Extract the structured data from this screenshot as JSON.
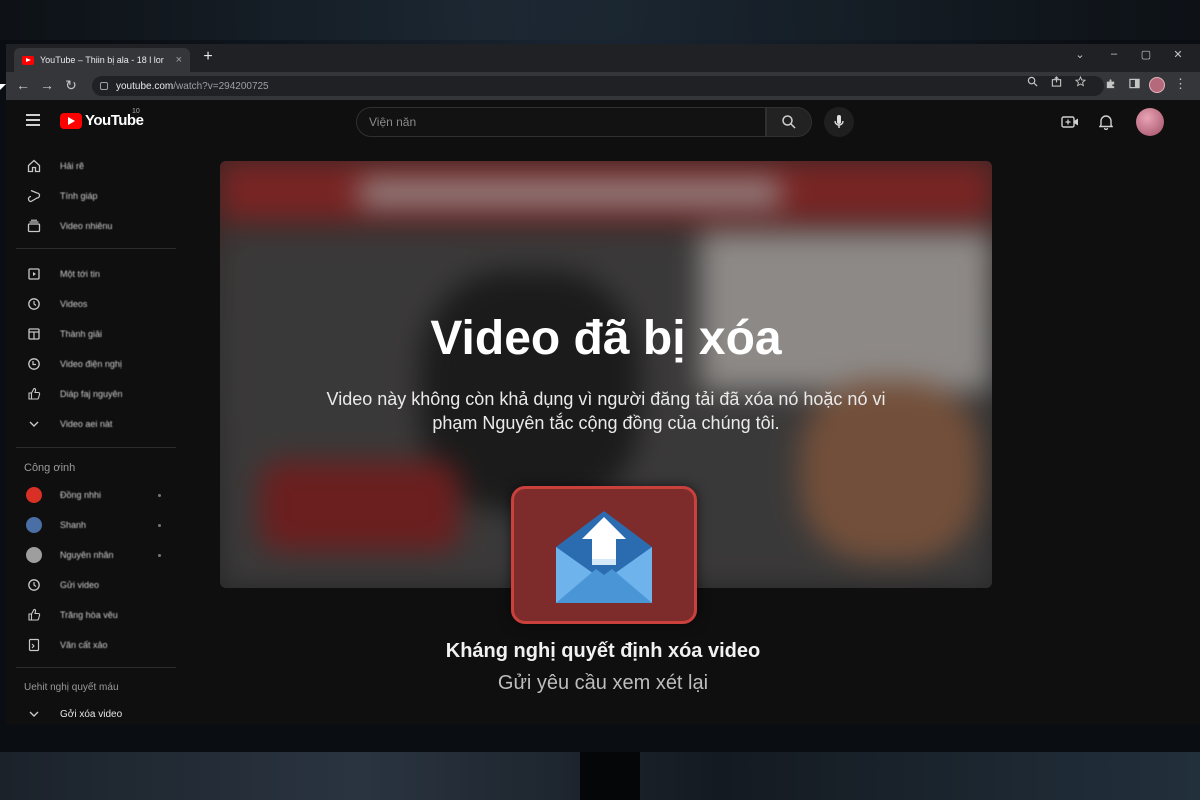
{
  "browser": {
    "tab_title": "YouTube – Thiin bị ala - 18 l lor",
    "tab_close": "×",
    "new_tab": "+",
    "url_host": "youtube.com",
    "url_path": "/watch?v=294200725",
    "win_min": "–",
    "win_max": "▢",
    "win_close": "✕",
    "win_list": "⌄",
    "nav_back": "←",
    "nav_forward": "→",
    "nav_reload": "↻"
  },
  "header": {
    "logo_text": "YouTube",
    "logo_country": "10",
    "search_placeholder": "Viện năn"
  },
  "sidebar": {
    "primary": [
      {
        "label": "Hải rẽ",
        "icon": "home-icon"
      },
      {
        "label": "Tính giáp",
        "icon": "shorts-icon"
      },
      {
        "label": "Video nhiênu",
        "icon": "subscriptions-icon"
      }
    ],
    "library": [
      {
        "label": "Một tới tin",
        "icon": "library-icon"
      },
      {
        "label": "Videos",
        "icon": "history-icon"
      },
      {
        "label": "Thành giải",
        "icon": "your-videos-icon"
      },
      {
        "label": "Video điện nghị",
        "icon": "watch-later-icon"
      },
      {
        "label": "Diáp faj nguyên",
        "icon": "liked-icon"
      },
      {
        "label": "Video aei nàt",
        "icon": "chevron-down-icon"
      }
    ],
    "subs_heading": "Công ơinh",
    "subscriptions": [
      {
        "label": "Đồng nhhi",
        "color": "#d93025"
      },
      {
        "label": "Shanh",
        "color": "#4a6fa5"
      },
      {
        "label": "Nguyên nhân",
        "color": "#9e9e9e"
      },
      {
        "label": "Gửi video",
        "color": "#000000"
      },
      {
        "label": "Trăng hòa vêu",
        "color": "#000000"
      },
      {
        "label": "Văn cất xảo",
        "color": "#000000"
      }
    ],
    "section_heading": "Uehit nghị quyết máu",
    "bottom_item": "Gởi xóa video"
  },
  "player": {
    "title": "Video đã bị xóa",
    "description": "Video này không còn khả dụng vì người đăng tải đã xóa nó hoặc nó vi phạm Nguyên tắc cộng đồng của chúng tôi."
  },
  "appeal": {
    "title": "Kháng nghị quyết định xóa video",
    "subtitle": "Gửi yêu cầu xem xét lại",
    "accent_color": "#c9403d"
  }
}
